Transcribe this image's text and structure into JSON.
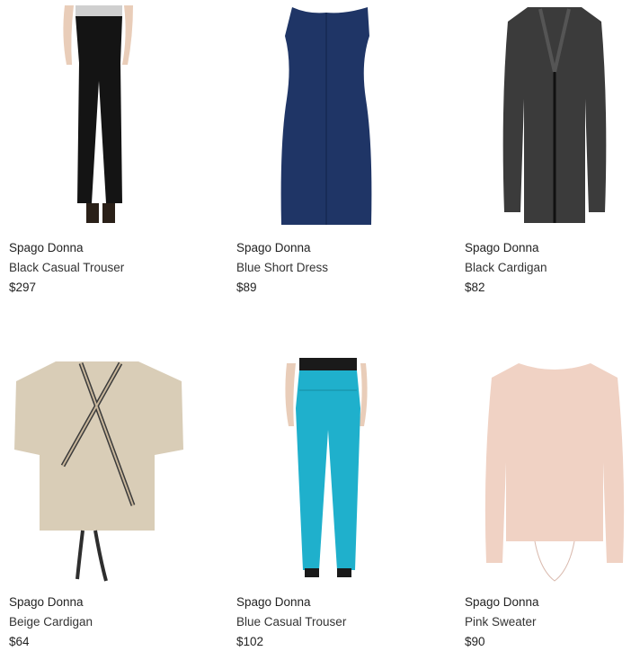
{
  "products": [
    {
      "brand": "Spago Donna",
      "name": "Black Casual Trouser",
      "price": "$297",
      "icon": "black-trouser-image"
    },
    {
      "brand": "Spago Donna",
      "name": "Blue Short Dress",
      "price": "$89",
      "icon": "blue-dress-image"
    },
    {
      "brand": "Spago Donna",
      "name": "Black Cardigan",
      "price": "$82",
      "icon": "black-cardigan-image"
    },
    {
      "brand": "Spago Donna",
      "name": "Beige Cardigan",
      "price": "$64",
      "icon": "beige-cardigan-image"
    },
    {
      "brand": "Spago Donna",
      "name": "Blue Casual Trouser",
      "price": "$102",
      "icon": "turquoise-trouser-image"
    },
    {
      "brand": "Spago Donna",
      "name": "Pink Sweater",
      "price": "$90",
      "icon": "pink-sweater-image"
    }
  ],
  "colors": {
    "black": "#141414",
    "navy": "#1f3566",
    "cardigan": "#2a2a2a",
    "beige": "#d9cdb7",
    "turquoise": "#1fb0cc",
    "pink": "#f0d2c4",
    "skin": "#e8c8b4",
    "text": "#222222"
  }
}
